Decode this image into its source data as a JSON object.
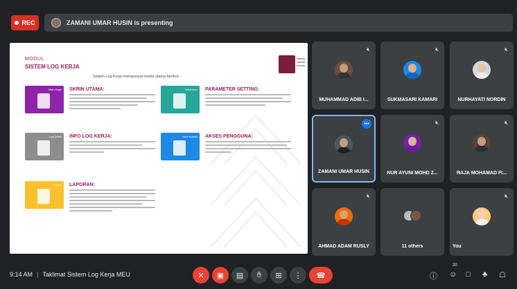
{
  "recording": {
    "label": "REC"
  },
  "presenting_banner": {
    "text": "ZAMANI UMAR HUSIN is presenting"
  },
  "slide": {
    "heading": "MODUL",
    "title": "SISTEM LOG KERJA",
    "intro": "Sistem Log Kerja mempunyai modul utama berikut:",
    "modules": [
      {
        "thumb_label": "Main Page",
        "title": "SKRIN UTAMA:",
        "color": "#8e24aa"
      },
      {
        "thumb_label": "Moderator",
        "title": "PARAMETER SETTING:",
        "color": "#26a69a"
      },
      {
        "thumb_label": "Log Detail",
        "title": "INFO LOG KERJA:",
        "color": "#8d8d8d"
      },
      {
        "thumb_label": "User Access",
        "title": "AKSES PENGGUNA:",
        "color": "#1e88e5"
      },
      {
        "thumb_label": "Report",
        "title": "LAPORAN:",
        "color": "#fbc02d"
      }
    ]
  },
  "participants": [
    {
      "name": "MUHAMMAD ADIB I...",
      "muted": true
    },
    {
      "name": "SUKMASARI KAMARI",
      "muted": true
    },
    {
      "name": "NURHAYATI NORDIN",
      "muted": true
    },
    {
      "name": "ZAMANI UMAR HUSIN",
      "muted": false,
      "speaking": true
    },
    {
      "name": "NUR AYUNI MOHD Z...",
      "muted": true
    },
    {
      "name": "RAJA MOHAMAD FI...",
      "muted": true
    },
    {
      "name": "AHMAD ADAM RUSLY",
      "muted": true
    },
    {
      "name": "11 others",
      "muted": false
    },
    {
      "name": "You",
      "muted": true
    }
  ],
  "footer": {
    "time": "9:14 AM",
    "separator": "|",
    "meeting_title": "Taklimat Sistem Log Kerja MEU",
    "participant_count": "20"
  },
  "colors": {
    "accent": "#8ab4f8",
    "danger": "#ea4335",
    "slide_accent": "#9b1b5a"
  }
}
